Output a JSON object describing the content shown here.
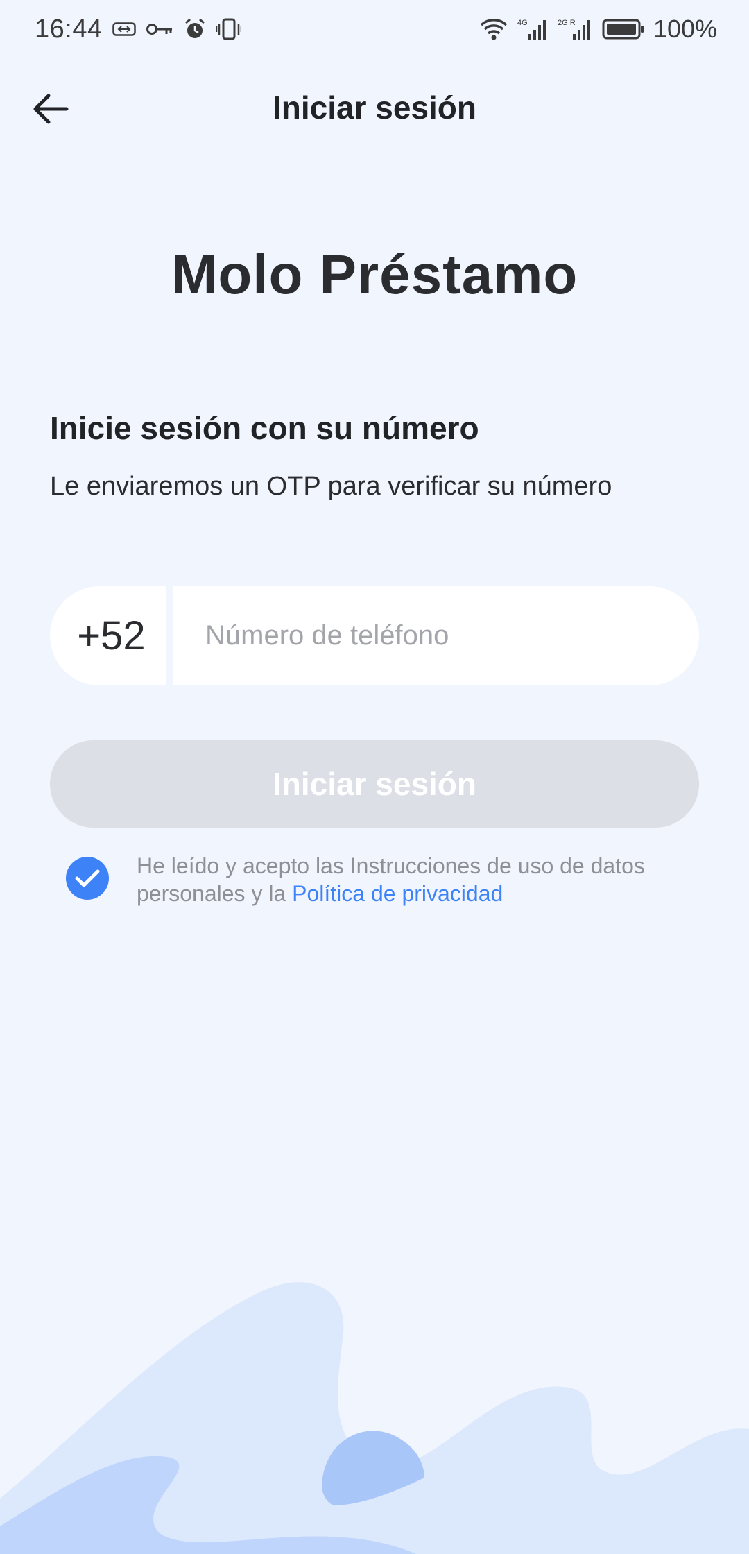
{
  "status_bar": {
    "time": "16:44",
    "battery_percent": "100%",
    "network_1": "4G",
    "network_2": "2G R",
    "icons": [
      "nfc-card-icon",
      "key-icon",
      "alarm-icon",
      "vibrate-icon",
      "wifi-icon",
      "signal-icon",
      "battery-icon"
    ]
  },
  "header": {
    "title": "Iniciar sesión",
    "back_icon": "arrow-left-icon"
  },
  "brand": {
    "app_name": "Molo Préstamo"
  },
  "login": {
    "heading": "Inicie sesión con su número",
    "subheading": "Le enviaremos un OTP para verificar su número",
    "country_code": "+52",
    "phone_value": "",
    "phone_placeholder": "Número de teléfono",
    "submit_label": "Iniciar sesión",
    "submit_enabled": false
  },
  "consent": {
    "checked": true,
    "text": "He leído y acepto las Instrucciones de uso de datos personales y la ",
    "link_text": "Política de privacidad"
  },
  "colors": {
    "background": "#F0F5FE",
    "accent": "#3E82F7",
    "button_disabled": "#DCDFE5",
    "wave_light": "#DCE8FC",
    "wave_mid": "#BFD5FB",
    "wave_dark": "#A9C6F8"
  }
}
